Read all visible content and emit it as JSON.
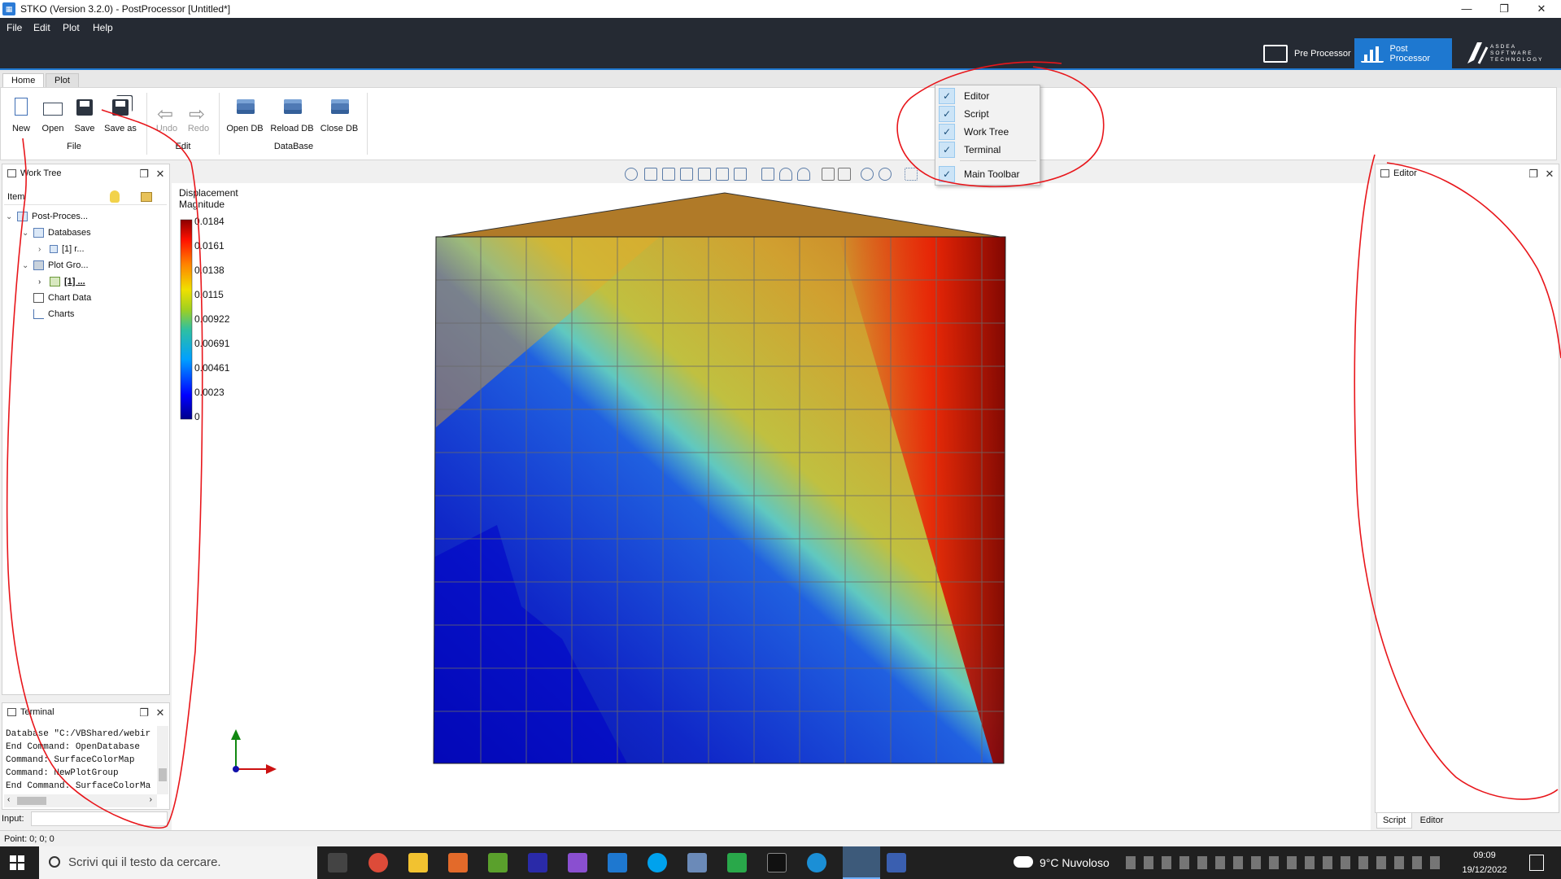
{
  "window": {
    "title": "STKO (Version 3.2.0) - PostProcessor [Untitled*]",
    "app_icon": "stko-icon"
  },
  "menu": {
    "items": [
      "File",
      "Edit",
      "Plot",
      "Help"
    ]
  },
  "modes": {
    "pre": "Pre Processor",
    "post": "Post Processor",
    "brand": "ASDEA SOFTWARE TECHNOLOGY"
  },
  "ribbon": {
    "tabs": [
      "Home",
      "Plot"
    ],
    "buttons": {
      "new": "New",
      "open": "Open",
      "save": "Save",
      "save_as": "Save as",
      "undo": "Undo",
      "redo": "Redo",
      "open_db": "Open DB",
      "reload_db": "Reload DB",
      "close_db": "Close DB"
    },
    "groups": {
      "file": "File",
      "edit": "Edit",
      "database": "DataBase"
    }
  },
  "context_menu": {
    "items": [
      "Editor",
      "Script",
      "Work Tree",
      "Terminal"
    ],
    "main_toolbar": "Main Toolbar"
  },
  "work_tree": {
    "title": "Work Tree",
    "column": "Item",
    "rows": {
      "root": "Post-Proces...",
      "databases": "Databases",
      "db1": "[1] r...",
      "plot_groups": "Plot Gro...",
      "pg1": "[1] ...",
      "chart_data": "Chart Data",
      "charts": "Charts"
    }
  },
  "terminal": {
    "title": "Terminal",
    "lines": "Database \"C:/VBShared/webir\nEnd Command: OpenDatabase\nCommand: SurfaceColorMap\nCommand: NewPlotGroup\nEnd Command: SurfaceColorMa",
    "input_label": "Input:"
  },
  "legend": {
    "title1": "Displacement",
    "title2": "Magnitude",
    "ticks": [
      "0.0184",
      "0.0161",
      "0.0138",
      "0.0115",
      "0.00922",
      "0.00691",
      "0.00461",
      "0.0023",
      "0"
    ]
  },
  "editor": {
    "title": "Editor",
    "tabs": [
      "Script",
      "Editor"
    ]
  },
  "status": {
    "text": "Point: 0; 0; 0"
  },
  "taskbar": {
    "search": "Scrivi qui il testo da cercare.",
    "weather": "9°C  Nuvoloso",
    "time": "09:09",
    "date": "19/12/2022"
  },
  "colors": {
    "accent": "#1e78d0",
    "menubar": "#252a33",
    "annotation": "#e8161b"
  }
}
